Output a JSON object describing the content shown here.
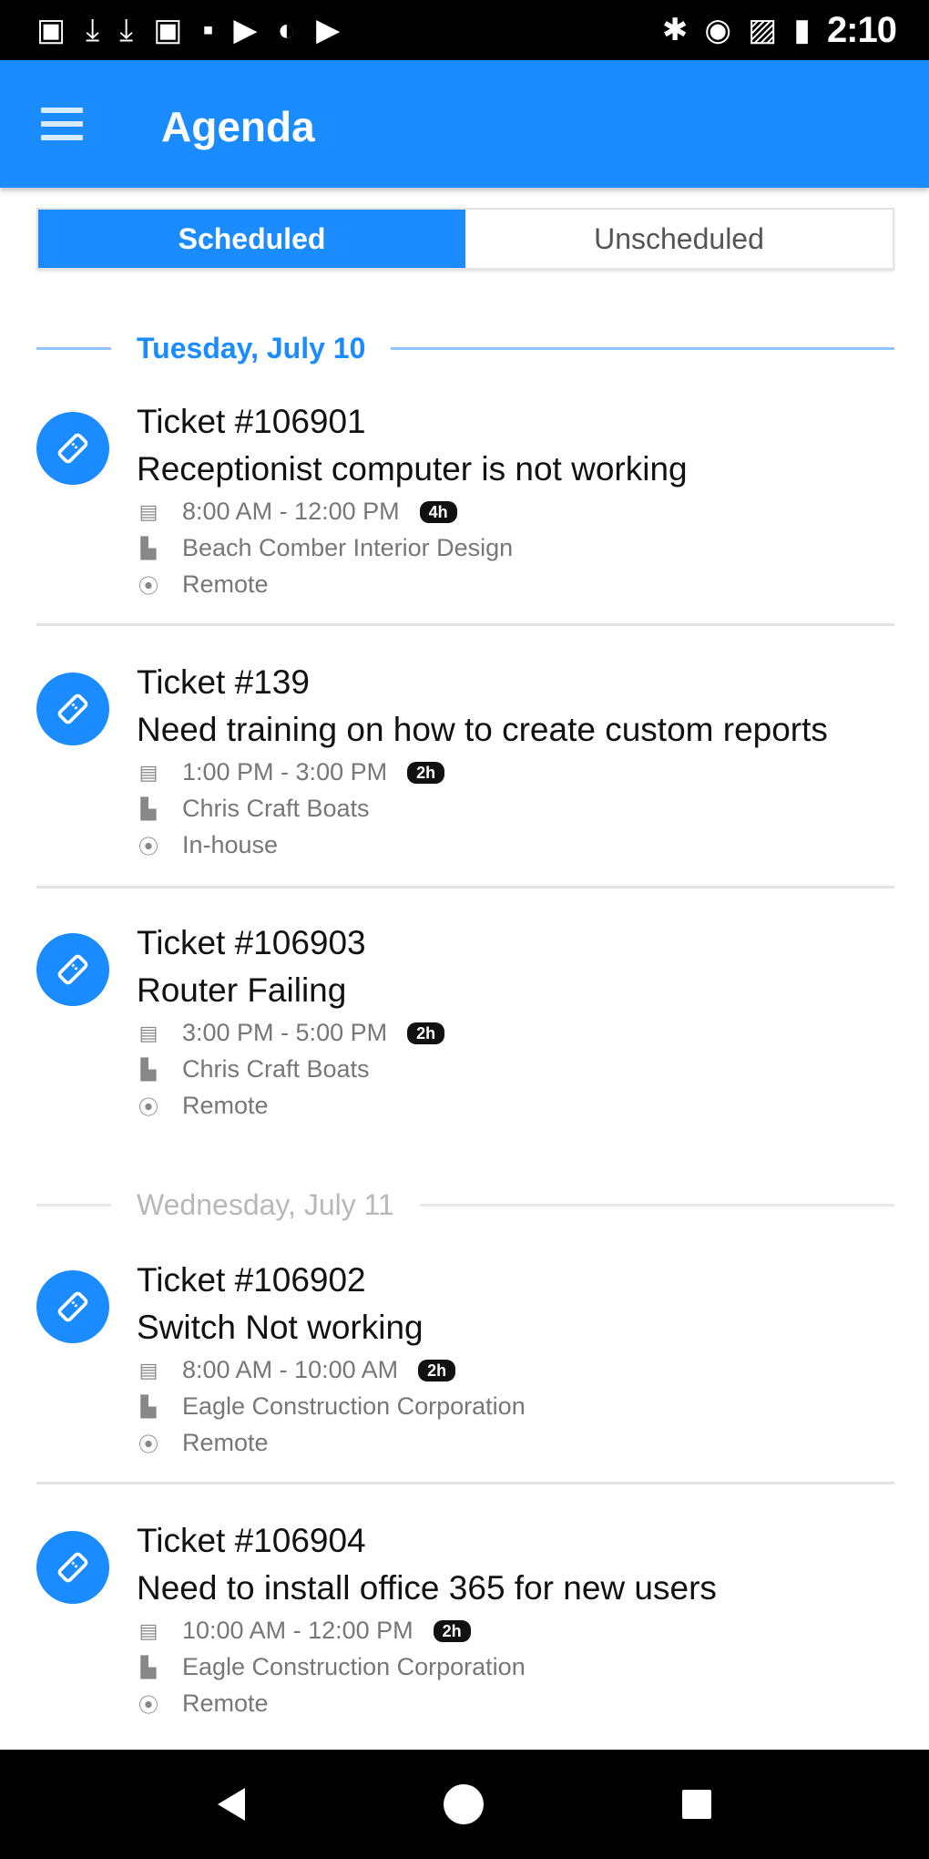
{
  "status_bar": {
    "time": "2:10"
  },
  "app_bar": {
    "title": "Agenda"
  },
  "tabs": {
    "scheduled": "Scheduled",
    "unscheduled": "Unscheduled",
    "active": "Scheduled"
  },
  "sections": [
    {
      "date": "Tuesday, July 10",
      "tickets": [
        {
          "number": "Ticket #106901",
          "subject": "Receptionist computer is not working",
          "time": "8:00 AM - 12:00 PM",
          "duration": "4h",
          "company": "Beach Comber Interior Design",
          "location": "Remote"
        },
        {
          "number": "Ticket #139",
          "subject": "Need training on how to create custom reports",
          "time": "1:00 PM - 3:00 PM",
          "duration": "2h",
          "company": "Chris Craft Boats",
          "location": "In-house"
        },
        {
          "number": "Ticket #106903",
          "subject": "Router Failing",
          "time": "3:00 PM - 5:00 PM",
          "duration": "2h",
          "company": "Chris Craft Boats",
          "location": "Remote"
        }
      ]
    },
    {
      "date": "Wednesday, July 11",
      "tickets": [
        {
          "number": "Ticket #106902",
          "subject": "Switch Not working",
          "time": "8:00 AM - 10:00 AM",
          "duration": "2h",
          "company": "Eagle Construction Corporation",
          "location": "Remote"
        },
        {
          "number": "Ticket #106904",
          "subject": "Need to install office 365 for new users",
          "time": "10:00 AM - 12:00 PM",
          "duration": "2h",
          "company": "Eagle Construction Corporation",
          "location": "Remote"
        }
      ]
    }
  ],
  "colors": {
    "primary": "#1a8cff",
    "status_bar": "#000000"
  },
  "icons": {
    "menu": "menu-icon",
    "ticket": "ticket-icon",
    "calendar": "calendar-icon",
    "company": "building-icon",
    "location": "location-pin-icon"
  }
}
